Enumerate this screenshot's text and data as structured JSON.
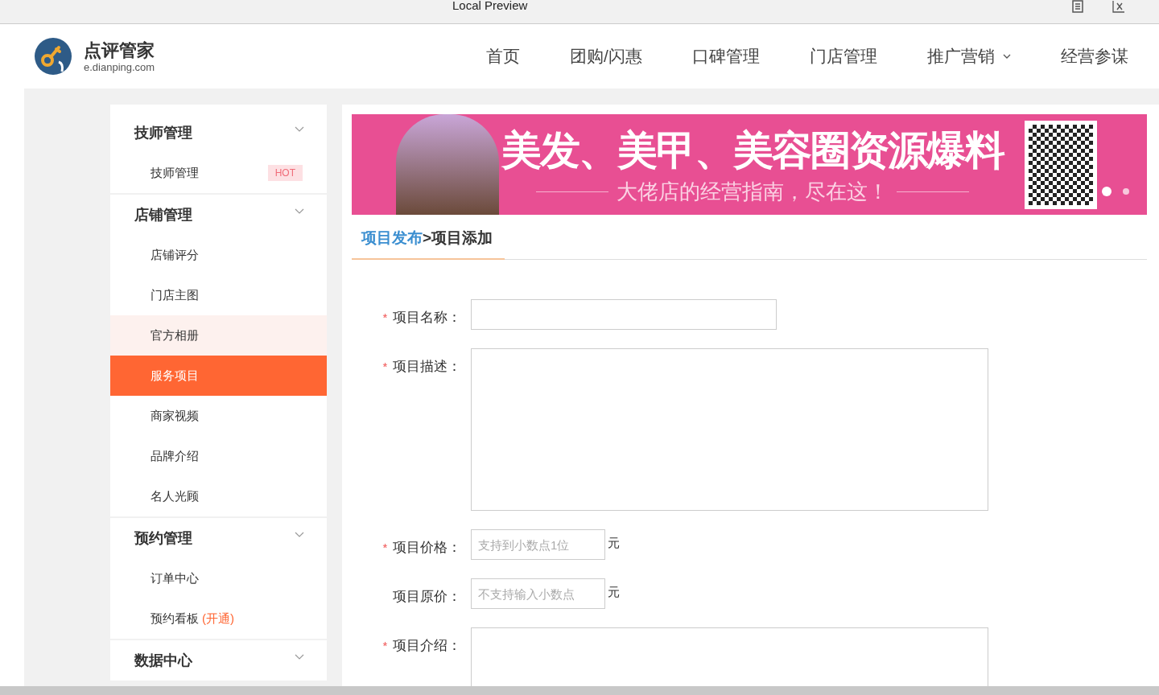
{
  "window": {
    "title": "Local Preview"
  },
  "logo": {
    "name": "点评管家",
    "domain": "e.dianping.com"
  },
  "nav": [
    {
      "label": "首页",
      "has_dropdown": false
    },
    {
      "label": "团购/闪惠",
      "has_dropdown": false
    },
    {
      "label": "口碑管理",
      "has_dropdown": false
    },
    {
      "label": "门店管理",
      "has_dropdown": false
    },
    {
      "label": "推广营销",
      "has_dropdown": true
    },
    {
      "label": "经营参谋",
      "has_dropdown": false
    }
  ],
  "sidebar": {
    "groups": [
      {
        "title": "技师管理",
        "items": [
          {
            "label": "技师管理",
            "badge": "HOT",
            "selected": false,
            "hovered": false
          }
        ]
      },
      {
        "title": "店铺管理",
        "items": [
          {
            "label": "店铺评分",
            "selected": false,
            "hovered": false
          },
          {
            "label": "门店主图",
            "selected": false,
            "hovered": false
          },
          {
            "label": "官方相册",
            "selected": false,
            "hovered": true
          },
          {
            "label": "服务项目",
            "selected": true,
            "hovered": false
          },
          {
            "label": "商家视频",
            "selected": false,
            "hovered": false
          },
          {
            "label": "品牌介绍",
            "selected": false,
            "hovered": false
          },
          {
            "label": "名人光顾",
            "selected": false,
            "hovered": false
          }
        ]
      },
      {
        "title": "预约管理",
        "items": [
          {
            "label": "订单中心",
            "selected": false,
            "hovered": false
          },
          {
            "label": "预约看板",
            "note": "(开通)",
            "selected": false,
            "hovered": false
          }
        ]
      },
      {
        "title": "数据中心"
      }
    ]
  },
  "banner": {
    "headline": "美发、美甲、美容圈资源爆料",
    "tagline": "大佬店的经营指南，尽在这！",
    "dots": [
      {
        "selected": true
      },
      {
        "selected": false
      }
    ]
  },
  "breadcrumb": {
    "link": "项目发布",
    "separator": ">",
    "current": "项目添加"
  },
  "form": [
    {
      "label": "项目名称：",
      "required_mark": "*",
      "kind": "text"
    },
    {
      "label": "项目描述：",
      "required_mark": "*",
      "kind": "textarea"
    },
    {
      "label": "项目价格：",
      "required_mark": "*",
      "kind": "price",
      "placeholder": "支持到小数点1位",
      "unit": "元"
    },
    {
      "label": "项目原价：",
      "kind": "price",
      "placeholder": "不支持输入小数点",
      "unit": "元"
    },
    {
      "label": "项目介绍：",
      "required_mark": "*",
      "kind": "textarea_cut"
    }
  ]
}
